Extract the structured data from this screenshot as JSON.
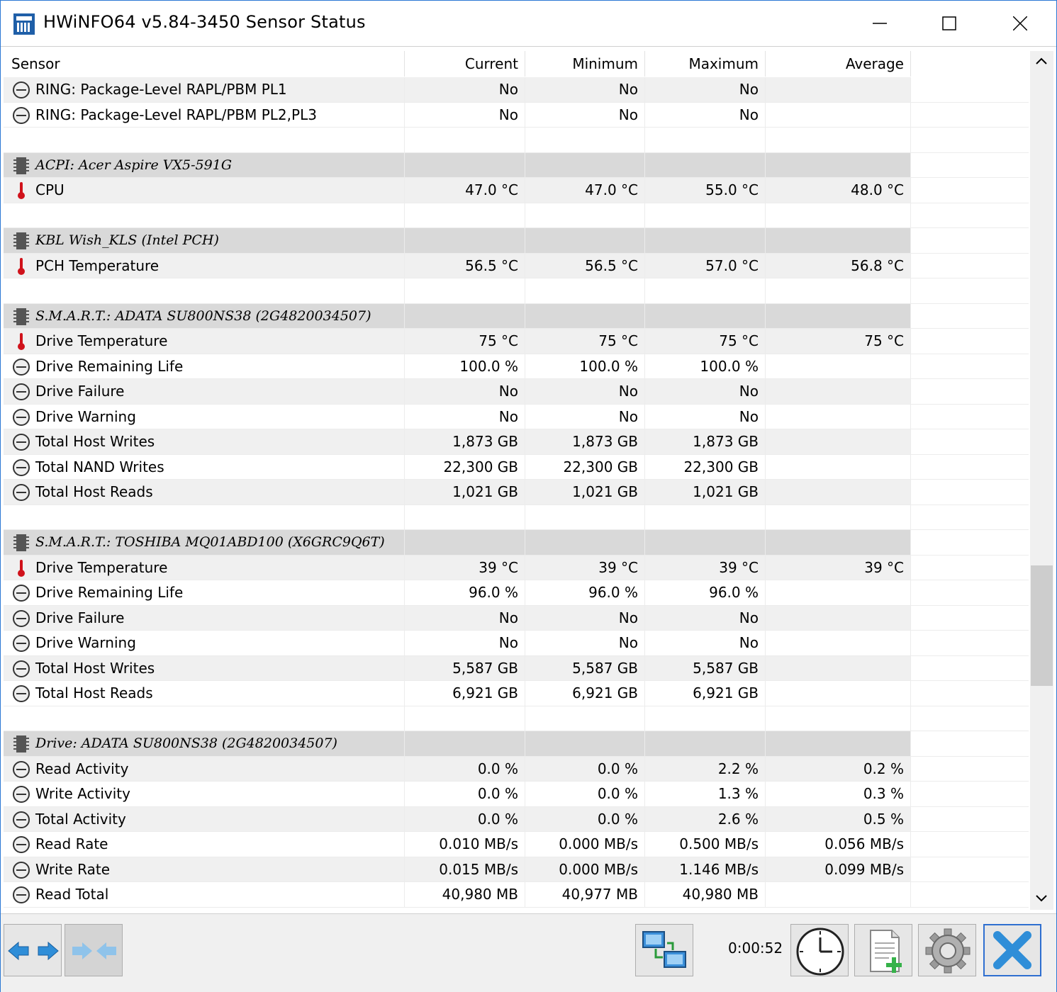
{
  "window": {
    "title": "HWiNFO64 v5.84-3450 Sensor Status"
  },
  "columns": {
    "sensor": "Sensor",
    "current": "Current",
    "minimum": "Minimum",
    "maximum": "Maximum",
    "average": "Average"
  },
  "rows": [
    {
      "type": "sensor",
      "icon": "gauge-icon",
      "name": "RING: Package-Level RAPL/PBM PL1",
      "current": "No",
      "minimum": "No",
      "maximum": "No",
      "average": ""
    },
    {
      "type": "sensor",
      "icon": "gauge-icon",
      "name": "RING: Package-Level RAPL/PBM PL2,PL3",
      "current": "No",
      "minimum": "No",
      "maximum": "No",
      "average": ""
    },
    {
      "type": "blank"
    },
    {
      "type": "group",
      "icon": "chip-icon",
      "name": "ACPI: Acer Aspire VX5-591G"
    },
    {
      "type": "sensor",
      "icon": "thermometer-icon",
      "name": "CPU",
      "current": "47.0 °C",
      "minimum": "47.0 °C",
      "maximum": "55.0 °C",
      "average": "48.0 °C"
    },
    {
      "type": "blank"
    },
    {
      "type": "group",
      "icon": "chip-icon",
      "name": "KBL Wish_KLS (Intel PCH)"
    },
    {
      "type": "sensor",
      "icon": "thermometer-icon",
      "name": "PCH Temperature",
      "current": "56.5 °C",
      "minimum": "56.5 °C",
      "maximum": "57.0 °C",
      "average": "56.8 °C"
    },
    {
      "type": "blank"
    },
    {
      "type": "group",
      "icon": "chip-icon",
      "name": "S.M.A.R.T.: ADATA SU800NS38 (2G4820034507)"
    },
    {
      "type": "sensor",
      "icon": "thermometer-icon",
      "name": "Drive Temperature",
      "current": "75 °C",
      "minimum": "75 °C",
      "maximum": "75 °C",
      "average": "75 °C"
    },
    {
      "type": "sensor",
      "icon": "gauge-icon",
      "name": "Drive Remaining Life",
      "current": "100.0 %",
      "minimum": "100.0 %",
      "maximum": "100.0 %",
      "average": ""
    },
    {
      "type": "sensor",
      "icon": "gauge-icon",
      "name": "Drive Failure",
      "current": "No",
      "minimum": "No",
      "maximum": "No",
      "average": ""
    },
    {
      "type": "sensor",
      "icon": "gauge-icon",
      "name": "Drive Warning",
      "current": "No",
      "minimum": "No",
      "maximum": "No",
      "average": ""
    },
    {
      "type": "sensor",
      "icon": "gauge-icon",
      "name": "Total Host Writes",
      "current": "1,873 GB",
      "minimum": "1,873 GB",
      "maximum": "1,873 GB",
      "average": ""
    },
    {
      "type": "sensor",
      "icon": "gauge-icon",
      "name": "Total NAND Writes",
      "current": "22,300 GB",
      "minimum": "22,300 GB",
      "maximum": "22,300 GB",
      "average": ""
    },
    {
      "type": "sensor",
      "icon": "gauge-icon",
      "name": "Total Host Reads",
      "current": "1,021 GB",
      "minimum": "1,021 GB",
      "maximum": "1,021 GB",
      "average": ""
    },
    {
      "type": "blank"
    },
    {
      "type": "group",
      "icon": "chip-icon",
      "name": "S.M.A.R.T.: TOSHIBA MQ01ABD100 (X6GRC9Q6T)"
    },
    {
      "type": "sensor",
      "icon": "thermometer-icon",
      "name": "Drive Temperature",
      "current": "39 °C",
      "minimum": "39 °C",
      "maximum": "39 °C",
      "average": "39 °C"
    },
    {
      "type": "sensor",
      "icon": "gauge-icon",
      "name": "Drive Remaining Life",
      "current": "96.0 %",
      "minimum": "96.0 %",
      "maximum": "96.0 %",
      "average": ""
    },
    {
      "type": "sensor",
      "icon": "gauge-icon",
      "name": "Drive Failure",
      "current": "No",
      "minimum": "No",
      "maximum": "No",
      "average": ""
    },
    {
      "type": "sensor",
      "icon": "gauge-icon",
      "name": "Drive Warning",
      "current": "No",
      "minimum": "No",
      "maximum": "No",
      "average": ""
    },
    {
      "type": "sensor",
      "icon": "gauge-icon",
      "name": "Total Host Writes",
      "current": "5,587 GB",
      "minimum": "5,587 GB",
      "maximum": "5,587 GB",
      "average": ""
    },
    {
      "type": "sensor",
      "icon": "gauge-icon",
      "name": "Total Host Reads",
      "current": "6,921 GB",
      "minimum": "6,921 GB",
      "maximum": "6,921 GB",
      "average": ""
    },
    {
      "type": "blank"
    },
    {
      "type": "group",
      "icon": "chip-icon",
      "name": "Drive: ADATA SU800NS38 (2G4820034507)"
    },
    {
      "type": "sensor",
      "icon": "gauge-icon",
      "name": "Read Activity",
      "current": "0.0 %",
      "minimum": "0.0 %",
      "maximum": "2.2 %",
      "average": "0.2 %"
    },
    {
      "type": "sensor",
      "icon": "gauge-icon",
      "name": "Write Activity",
      "current": "0.0 %",
      "minimum": "0.0 %",
      "maximum": "1.3 %",
      "average": "0.3 %"
    },
    {
      "type": "sensor",
      "icon": "gauge-icon",
      "name": "Total Activity",
      "current": "0.0 %",
      "minimum": "0.0 %",
      "maximum": "2.6 %",
      "average": "0.5 %"
    },
    {
      "type": "sensor",
      "icon": "gauge-icon",
      "name": "Read Rate",
      "current": "0.010 MB/s",
      "minimum": "0.000 MB/s",
      "maximum": "0.500 MB/s",
      "average": "0.056 MB/s"
    },
    {
      "type": "sensor",
      "icon": "gauge-icon",
      "name": "Write Rate",
      "current": "0.015 MB/s",
      "minimum": "0.000 MB/s",
      "maximum": "1.146 MB/s",
      "average": "0.099 MB/s"
    },
    {
      "type": "sensor",
      "icon": "gauge-icon",
      "name": "Read Total",
      "current": "40,980 MB",
      "minimum": "40,977 MB",
      "maximum": "40,980 MB",
      "average": ""
    }
  ],
  "toolbar": {
    "elapsed_time": "0:00:52",
    "buttons": [
      "expand-columns-icon",
      "collapse-columns-icon",
      "network-icon",
      "clock-icon",
      "log-file-icon",
      "settings-gear-icon",
      "close-x-icon"
    ]
  },
  "colors": {
    "group_row": "#d9d9d9",
    "shaded_row": "#f0f0f0",
    "accent_blue": "#2f8ed8",
    "thermometer_red": "#d0121b"
  }
}
